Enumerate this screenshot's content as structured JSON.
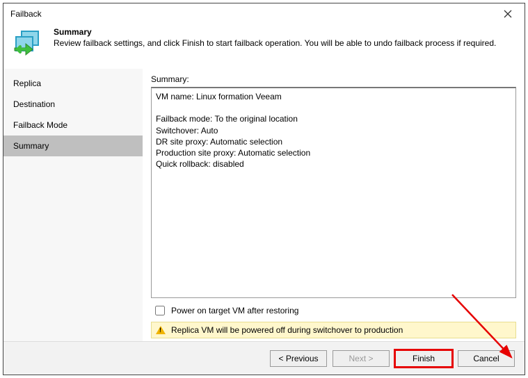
{
  "window": {
    "title": "Failback"
  },
  "header": {
    "title": "Summary",
    "description": "Review failback settings, and click Finish to start failback operation. You will be able to undo failback process if required."
  },
  "sidebar": {
    "items": [
      {
        "label": "Replica"
      },
      {
        "label": "Destination"
      },
      {
        "label": "Failback Mode"
      },
      {
        "label": "Summary"
      }
    ]
  },
  "main": {
    "summary_label": "Summary:",
    "summary_text": "VM name: Linux formation Veeam\n\nFailback mode: To the original location\nSwitchover: Auto\nDR site proxy: Automatic selection\nProduction site proxy: Automatic selection\nQuick rollback: disabled",
    "checkbox_label": "Power on target VM after restoring",
    "warning_text": "Replica VM will be powered off during switchover to production"
  },
  "footer": {
    "previous": "< Previous",
    "next": "Next >",
    "finish": "Finish",
    "cancel": "Cancel"
  }
}
